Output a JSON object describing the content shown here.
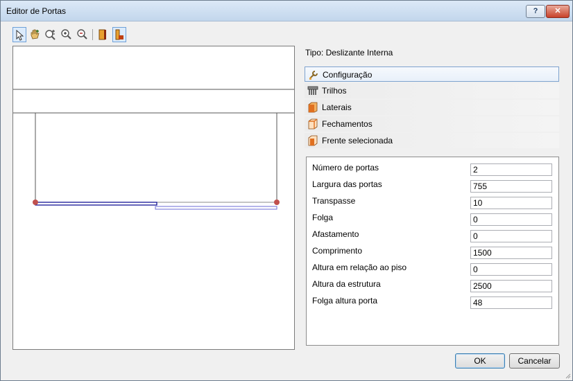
{
  "window": {
    "title": "Editor de Portas",
    "help_label": "?",
    "close_label": "✕"
  },
  "toolbar": {
    "tools": [
      {
        "name": "select-tool",
        "glyph": "⬉"
      },
      {
        "name": "pan-tool",
        "glyph": "✋"
      },
      {
        "name": "zoom-plus-minus-tool",
        "glyph": "🔍"
      },
      {
        "name": "zoom-in-tool",
        "glyph": "⊕"
      },
      {
        "name": "zoom-out-tool",
        "glyph": "⊖"
      },
      {
        "name": "door-view-front-tool",
        "glyph": "▌"
      },
      {
        "name": "door-view-side-tool",
        "glyph": "▙"
      }
    ]
  },
  "info": {
    "type_label": "Tipo: Deslizante Interna"
  },
  "sections": [
    {
      "label": "Configuração",
      "icon": "wrench-icon",
      "selected": true
    },
    {
      "label": "Trilhos",
      "icon": "rails-icon",
      "selected": false
    },
    {
      "label": "Laterais",
      "icon": "side-panel-icon",
      "selected": false
    },
    {
      "label": "Fechamentos",
      "icon": "closure-icon",
      "selected": false
    },
    {
      "label": "Frente selecionada",
      "icon": "front-panel-icon",
      "selected": false
    }
  ],
  "properties": [
    {
      "label": "Número de portas",
      "value": "2"
    },
    {
      "label": "Largura das portas",
      "value": "755"
    },
    {
      "label": "Transpasse",
      "value": "10"
    },
    {
      "label": "Folga",
      "value": "0"
    },
    {
      "label": "Afastamento",
      "value": "0"
    },
    {
      "label": "Comprimento",
      "value": "1500"
    },
    {
      "label": "Altura em relação ao piso",
      "value": "0"
    },
    {
      "label": "Altura da estrutura",
      "value": "2500"
    },
    {
      "label": "Folga altura porta",
      "value": "48"
    }
  ],
  "buttons": {
    "ok": "OK",
    "cancel": "Cancelar"
  },
  "colors": {
    "door_front": "#00008b",
    "door_back": "#6b6bd6",
    "pivot": "#c0504d",
    "accent": "#3c7fb1"
  }
}
